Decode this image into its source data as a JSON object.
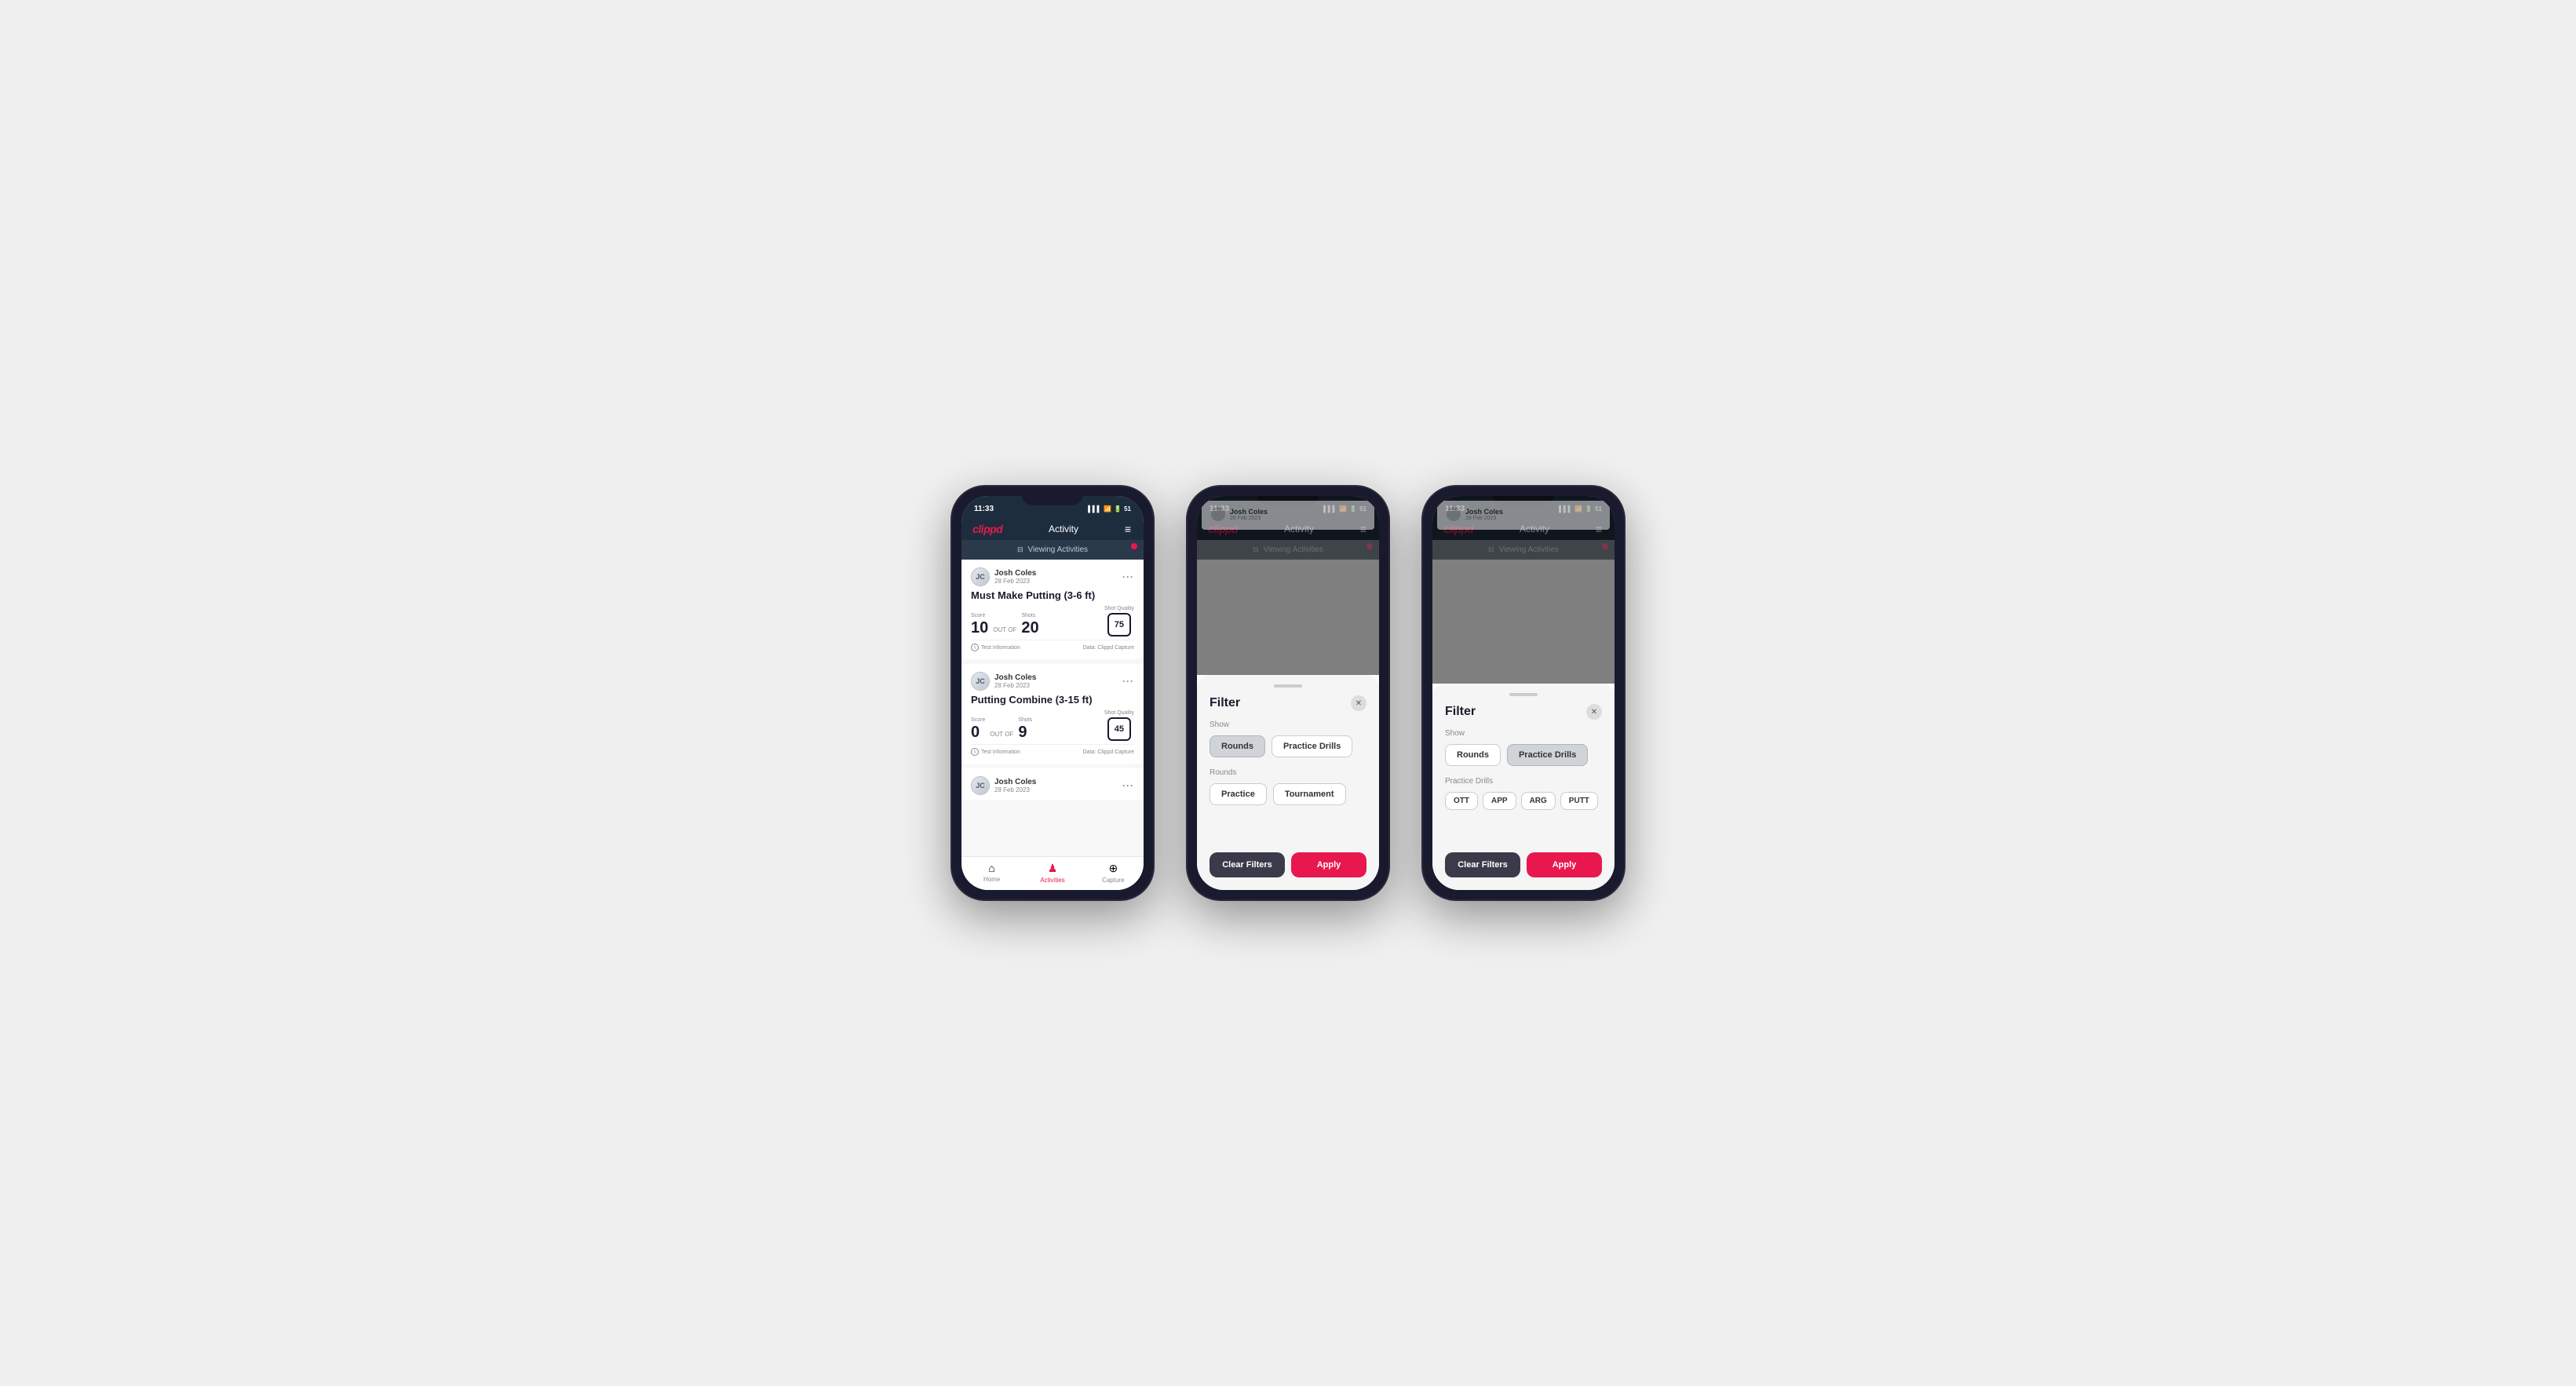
{
  "statusBar": {
    "time": "11:33",
    "signal": "▌▌▌",
    "wifi": "WiFi",
    "battery": "51"
  },
  "header": {
    "logo": "clippd",
    "title": "Activity",
    "menuIcon": "≡"
  },
  "viewingBar": {
    "icon": "⊞",
    "text": "Viewing Activities"
  },
  "activities": [
    {
      "userName": "Josh Coles",
      "userDate": "28 Feb 2023",
      "title": "Must Make Putting (3-6 ft)",
      "scoreLabel": "Score",
      "scoreValue": "10",
      "outOfLabel": "OUT OF",
      "outOfValue": "20",
      "shotsLabel": "Shots",
      "shotsValue": "20",
      "shotQualityLabel": "Shot Quality",
      "shotQualityValue": "75",
      "testInfo": "Test Information",
      "dataSource": "Data: Clippd Capture"
    },
    {
      "userName": "Josh Coles",
      "userDate": "28 Feb 2023",
      "title": "Putting Combine (3-15 ft)",
      "scoreLabel": "Score",
      "scoreValue": "0",
      "outOfLabel": "OUT OF",
      "outOfValue": "9",
      "shotsLabel": "Shots",
      "shotsValue": "9",
      "shotQualityLabel": "Shot Quality",
      "shotQualityValue": "45",
      "testInfo": "Test Information",
      "dataSource": "Data: Clippd Capture"
    },
    {
      "userName": "Josh Coles",
      "userDate": "28 Feb 2023",
      "title": "",
      "scoreLabel": "",
      "scoreValue": "",
      "outOfLabel": "",
      "outOfValue": "",
      "shotsLabel": "",
      "shotsValue": "",
      "shotQualityLabel": "",
      "shotQualityValue": "",
      "testInfo": "",
      "dataSource": ""
    }
  ],
  "bottomNav": [
    {
      "icon": "⌂",
      "label": "Home",
      "active": false
    },
    {
      "icon": "♟",
      "label": "Activities",
      "active": true
    },
    {
      "icon": "⊕",
      "label": "Capture",
      "active": false
    }
  ],
  "filter": {
    "title": "Filter",
    "showLabel": "Show",
    "roundsBtn": "Rounds",
    "practiceDrillsBtn": "Practice Drills",
    "roundsSectionLabel": "Rounds",
    "practiceBtn": "Practice",
    "tournamentBtn": "Tournament",
    "drillsSectionLabel": "Practice Drills",
    "drillTags": [
      "OTT",
      "APP",
      "ARG",
      "PUTT"
    ],
    "clearFiltersLabel": "Clear Filters",
    "applyLabel": "Apply"
  }
}
